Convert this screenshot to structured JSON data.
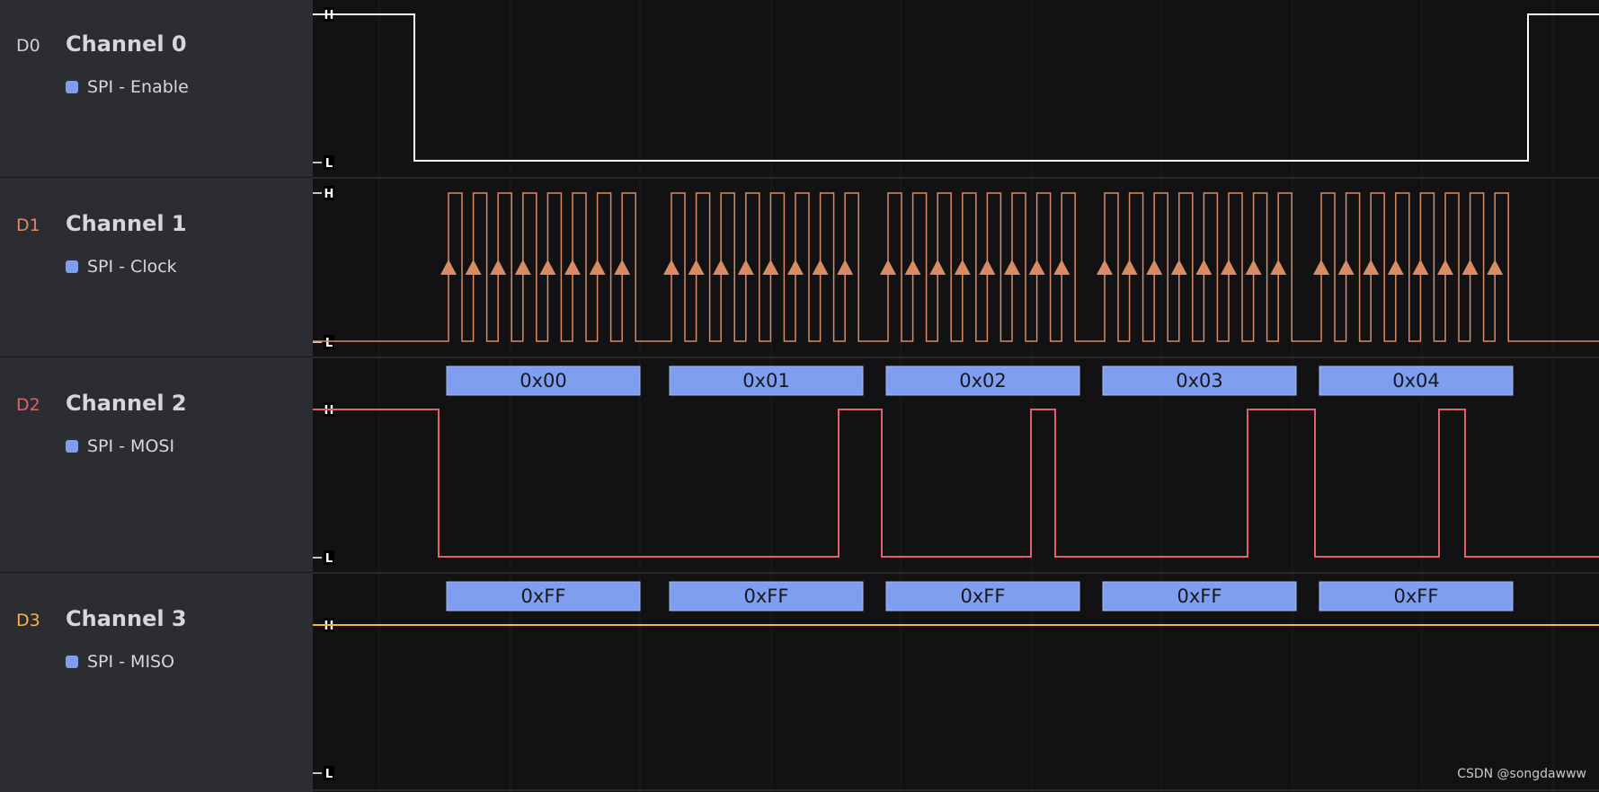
{
  "colors": {
    "d0": "#ffffff",
    "d1": "#d98b63",
    "d2": "#e0616a",
    "d3": "#f3b24a",
    "protocol": "#7f9ef0",
    "id_d0": "#cfd0d4"
  },
  "level_labels": {
    "high": "H",
    "low": "L"
  },
  "channels": [
    {
      "id": "D0",
      "name": "Channel 0",
      "analyzer": "SPI - Enable"
    },
    {
      "id": "D1",
      "name": "Channel 1",
      "analyzer": "SPI - Clock"
    },
    {
      "id": "D2",
      "name": "Channel 2",
      "analyzer": "SPI - MOSI"
    },
    {
      "id": "D3",
      "name": "Channel 3",
      "analyzer": "SPI - MISO"
    }
  ],
  "decoded": {
    "mosi": [
      "0x00",
      "0x01",
      "0x02",
      "0x03",
      "0x04"
    ],
    "miso": [
      "0xFF",
      "0xFF",
      "0xFF",
      "0xFF",
      "0xFF"
    ]
  },
  "watermark": "CSDN @songdawww"
}
